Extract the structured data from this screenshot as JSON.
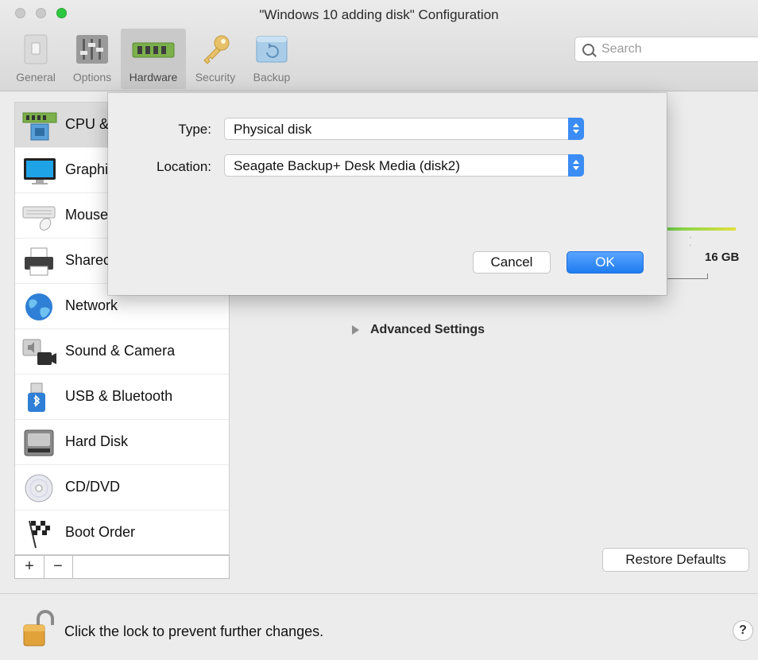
{
  "window": {
    "title": "\"Windows 10 adding disk\" Configuration"
  },
  "toolbar": {
    "items": [
      {
        "label": "General",
        "icon": "general-icon"
      },
      {
        "label": "Options",
        "icon": "options-sliders-icon"
      },
      {
        "label": "Hardware",
        "icon": "hardware-chip-icon",
        "selected": true
      },
      {
        "label": "Security",
        "icon": "key-icon"
      },
      {
        "label": "Backup",
        "icon": "backup-icon"
      }
    ]
  },
  "search": {
    "placeholder": "Search"
  },
  "sidebar": {
    "items": [
      {
        "label": "CPU &",
        "icon": "cpu-memory-icon",
        "selected": true
      },
      {
        "label": "Graphi",
        "icon": "monitor-icon"
      },
      {
        "label": "Mouse",
        "icon": "keyboard-mouse-icon"
      },
      {
        "label": "Sharec",
        "icon": "printer-icon"
      },
      {
        "label": "Network",
        "icon": "globe-icon"
      },
      {
        "label": "Sound & Camera",
        "icon": "speaker-camera-icon"
      },
      {
        "label": "USB & Bluetooth",
        "icon": "usb-bluetooth-icon"
      },
      {
        "label": "Hard Disk",
        "icon": "hard-disk-icon"
      },
      {
        "label": "CD/DVD",
        "icon": "cd-dvd-icon"
      },
      {
        "label": "Boot Order",
        "icon": "boot-order-flag-icon"
      }
    ],
    "add_label": "+",
    "remove_label": "−"
  },
  "main": {
    "advanced_settings": "Advanced Settings",
    "memory_max_label": "16 GB",
    "tick_marks": "' '",
    "restore_defaults": "Restore Defaults"
  },
  "sheet": {
    "type_label": "Type:",
    "type_value": "Physical disk",
    "location_label": "Location:",
    "location_value": "Seagate Backup+ Desk Media (disk2)",
    "cancel_label": "Cancel",
    "ok_label": "OK"
  },
  "footer": {
    "lock_text": "Click the lock to prevent further changes.",
    "help_label": "?"
  },
  "colors": {
    "accent": "#3b8cf5",
    "selected_item": "#dcdcdc"
  }
}
